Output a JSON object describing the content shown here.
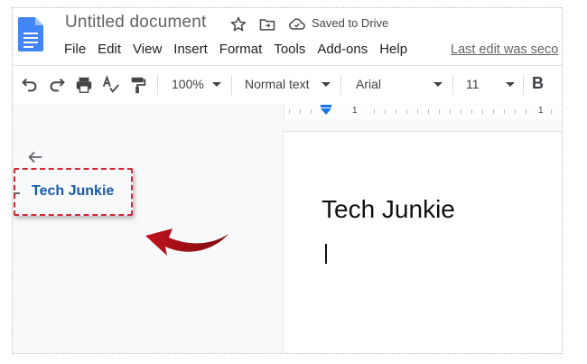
{
  "title_bar": {
    "doc_title": "Untitled document",
    "saved_status": "Saved to Drive"
  },
  "menu": {
    "items": [
      "File",
      "Edit",
      "View",
      "Insert",
      "Format",
      "Tools",
      "Add-ons",
      "Help"
    ],
    "last_edit": "Last edit was seco"
  },
  "toolbar": {
    "zoom": "100%",
    "style": "Normal text",
    "font": "Arial",
    "size": "11",
    "bold_label": "B"
  },
  "ruler": {
    "left_num": "1",
    "right_num": "1"
  },
  "outline": {
    "heading_item": "Tech Junkie"
  },
  "document": {
    "heading": "Tech Junkie"
  },
  "colors": {
    "docs_blue": "#4285f4",
    "highlight_red": "#d3283a",
    "outline_text": "#1a5aa9",
    "arrow_red": "#b20d16"
  }
}
